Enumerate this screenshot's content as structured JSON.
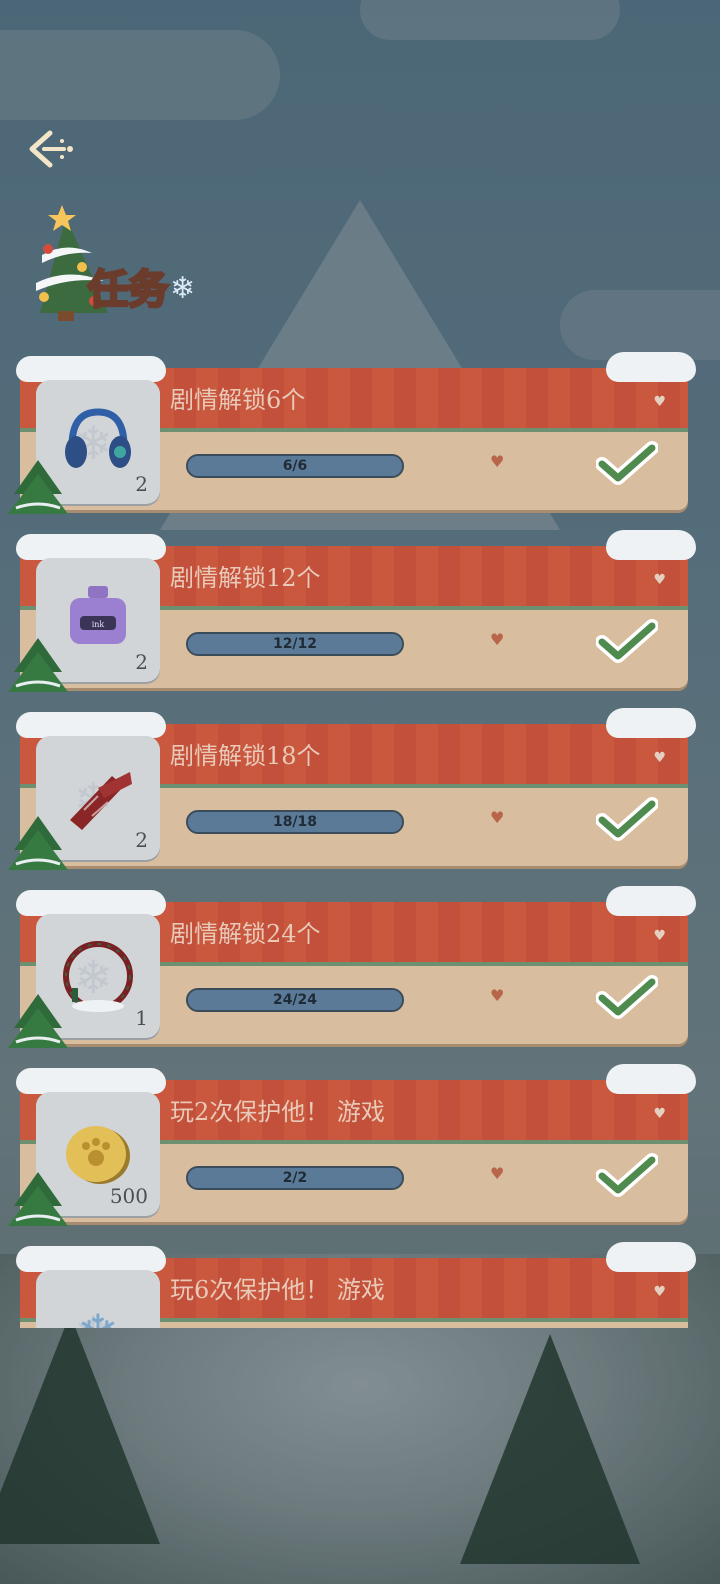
{
  "header": {
    "back_icon": "back-arrow-icon",
    "title": "任务"
  },
  "colors": {
    "card_head": "#c9583f",
    "card_body": "#d9bd9f",
    "progress": "#5b7a98",
    "check": "#4f8a4f"
  },
  "tasks": [
    {
      "title": "剧情解锁6个",
      "count": "2",
      "progress_text": "6/6",
      "progress": 1.0,
      "completed": true,
      "icon": "headphones-icon"
    },
    {
      "title": "剧情解锁12个",
      "count": "2",
      "progress_text": "12/12",
      "progress": 1.0,
      "completed": true,
      "icon": "ink-bottle-icon"
    },
    {
      "title": "剧情解锁18个",
      "count": "2",
      "progress_text": "18/18",
      "progress": 1.0,
      "completed": true,
      "icon": "tie-icon"
    },
    {
      "title": "剧情解锁24个",
      "count": "1",
      "progress_text": "24/24",
      "progress": 1.0,
      "completed": true,
      "icon": "wreath-frame-icon"
    },
    {
      "title": "玩2次保护他！ 游戏",
      "count": "500",
      "progress_text": "2/2",
      "progress": 1.0,
      "completed": true,
      "icon": "gold-coin-icon"
    },
    {
      "title": "玩6次保护他！ 游戏",
      "count": "",
      "progress_text": "",
      "progress": null,
      "completed": null,
      "icon": "snowflake-icon"
    }
  ]
}
